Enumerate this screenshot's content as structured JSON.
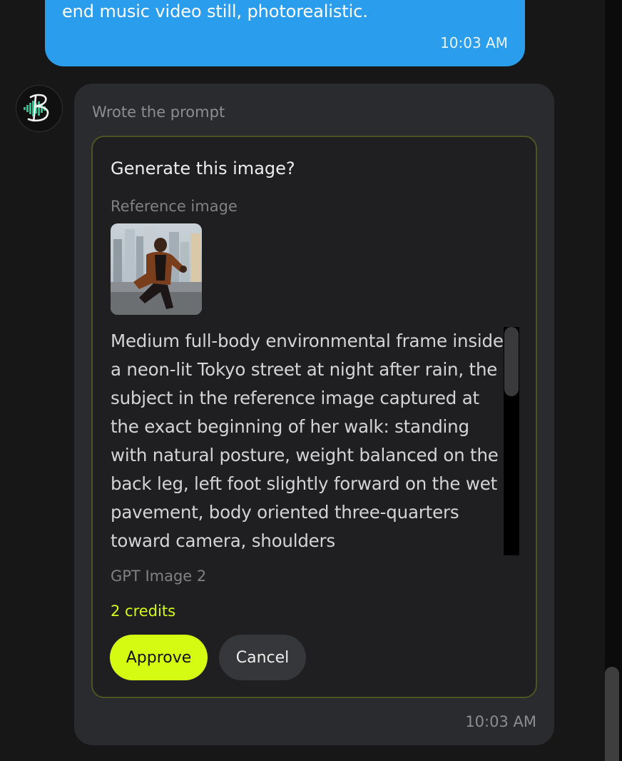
{
  "user_message": {
    "text_tail": "end music video still, photorealistic.",
    "time": "10:03 AM"
  },
  "assistant": {
    "avatar_icon": "b-logo-icon",
    "status": "Wrote the prompt",
    "time": "10:03 AM",
    "approval": {
      "title": "Generate this image?",
      "reference_label": "Reference image",
      "reference_image": "man-running-city-skyline-thumbnail",
      "prompt": "Medium full-body environmental frame inside a neon-lit Tokyo street at night after rain, the subject in the reference image captured at the exact beginning of her walk: standing with natural posture, weight balanced on the back leg, left foot slightly forward on the wet pavement, body oriented three-quarters toward camera, shoulders",
      "model": "GPT Image 2",
      "credits": "2 credits",
      "approve_label": "Approve",
      "cancel_label": "Cancel"
    }
  },
  "colors": {
    "user_bubble": "#2a9ded",
    "accent": "#d6fb13",
    "card": "#2a2b2e",
    "background": "#171717"
  }
}
